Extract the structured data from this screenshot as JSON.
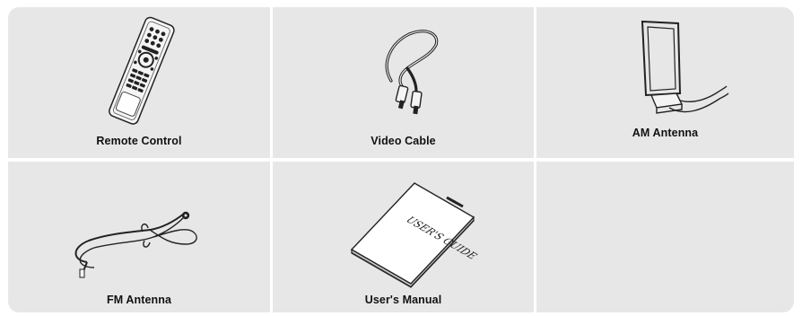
{
  "accessories": [
    {
      "label": "Remote Control",
      "icon": "remote-control-icon"
    },
    {
      "label": "Video Cable",
      "icon": "video-cable-icon"
    },
    {
      "label": "AM Antenna",
      "icon": "am-antenna-icon"
    },
    {
      "label": "FM Antenna",
      "icon": "fm-antenna-icon"
    },
    {
      "label": "User's Manual",
      "icon": "users-manual-icon"
    },
    {
      "label": "",
      "icon": ""
    }
  ],
  "manual_cover_text": "USER'S GUIDE",
  "colors": {
    "cell_background": "#e7e7e7",
    "line_art": "#222222"
  }
}
